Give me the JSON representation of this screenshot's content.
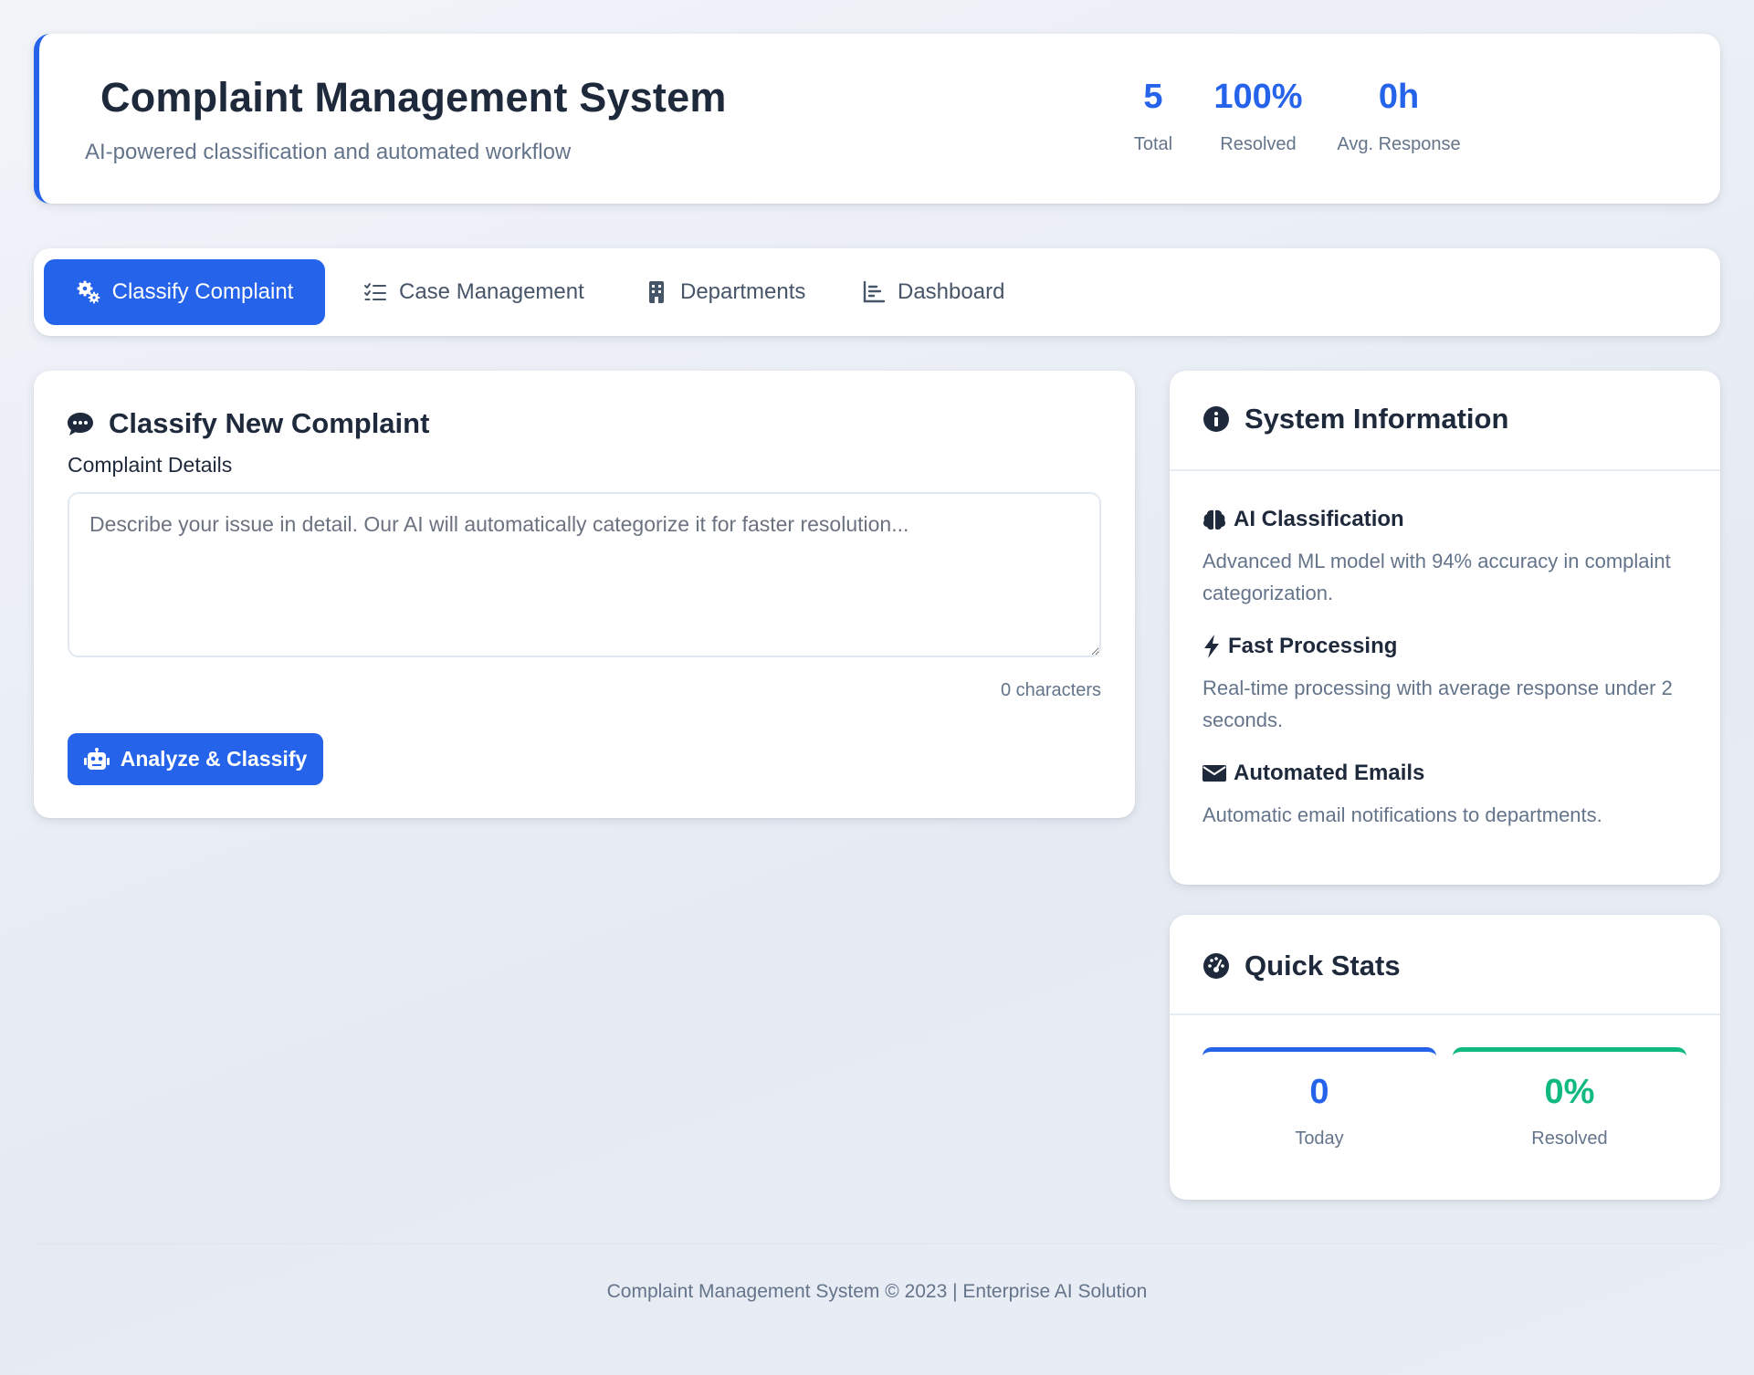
{
  "header": {
    "title": "Complaint Management System",
    "subtitle": "AI-powered classification and automated workflow",
    "stats": [
      {
        "value": "5",
        "label": "Total"
      },
      {
        "value": "100%",
        "label": "Resolved"
      },
      {
        "value": "0h",
        "label": "Avg. Response"
      }
    ]
  },
  "tabs": [
    {
      "label": "Classify Complaint",
      "icon": "cogs-icon",
      "active": true
    },
    {
      "label": "Case Management",
      "icon": "list-check-icon",
      "active": false
    },
    {
      "label": "Departments",
      "icon": "building-icon",
      "active": false
    },
    {
      "label": "Dashboard",
      "icon": "chart-icon",
      "active": false
    }
  ],
  "classify": {
    "title": "Classify New Complaint",
    "field_label": "Complaint Details",
    "placeholder": "Describe your issue in detail. Our AI will automatically categorize it for faster resolution...",
    "value": "",
    "char_count": "0 characters",
    "button_label": "Analyze & Classify"
  },
  "system_info": {
    "title": "System Information",
    "items": [
      {
        "title": "AI Classification",
        "icon": "brain-icon",
        "description": "Advanced ML model with 94% accuracy in complaint categorization."
      },
      {
        "title": "Fast Processing",
        "icon": "bolt-icon",
        "description": "Real-time processing with average response under 2 seconds."
      },
      {
        "title": "Automated Emails",
        "icon": "envelope-icon",
        "description": "Automatic email notifications to departments."
      }
    ]
  },
  "quick_stats": {
    "title": "Quick Stats",
    "items": [
      {
        "value": "0",
        "label": "Today",
        "color": "#2563eb"
      },
      {
        "value": "0%",
        "label": "Resolved",
        "color": "#10b981"
      }
    ]
  },
  "footer": {
    "text": "Complaint Management System © 2023 | Enterprise AI Solution"
  },
  "colors": {
    "accent": "#2563eb",
    "success": "#10b981",
    "text": "#1e293b",
    "muted": "#64748b"
  }
}
